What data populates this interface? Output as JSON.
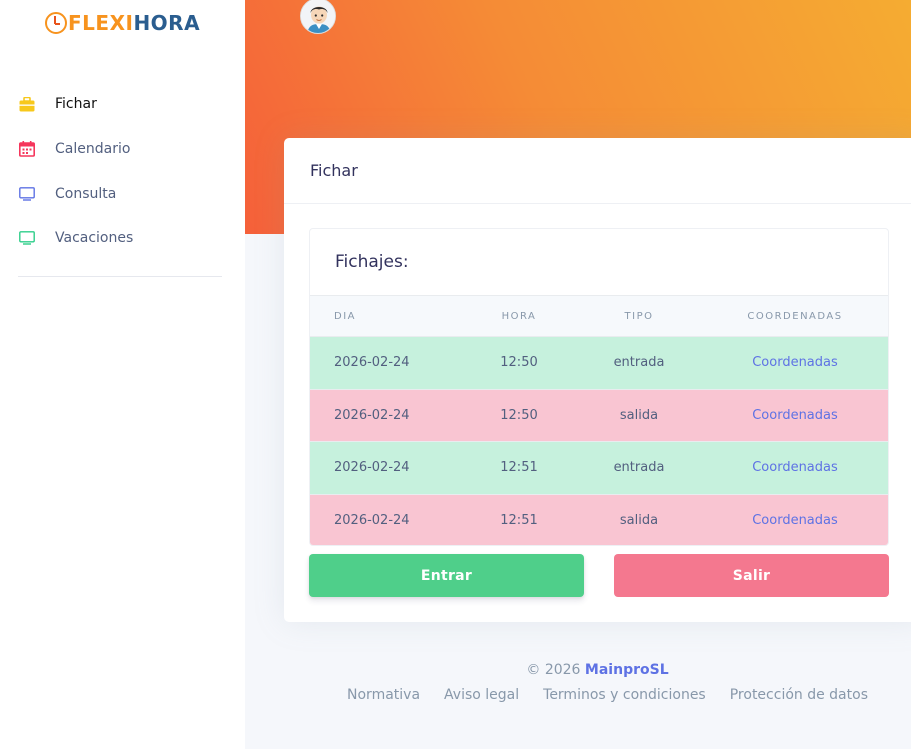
{
  "sidebar": {
    "logo": {
      "part1": "FLEXI",
      "part2": "HORA"
    },
    "items": [
      {
        "label": "Fichar",
        "icon": "briefcase-icon",
        "color": "#f7c81b"
      },
      {
        "label": "Calendario",
        "icon": "calendar-icon",
        "color": "#f5365c"
      },
      {
        "label": "Consulta",
        "icon": "monitor-icon",
        "color": "#5e72e4"
      },
      {
        "label": "Vacaciones",
        "icon": "monitor-icon",
        "color": "#2dce89"
      }
    ]
  },
  "card": {
    "title": "Fichar",
    "inner_title": "Fichajes:",
    "columns": [
      "Dia",
      "Hora",
      "Tipo",
      "Coordenadas"
    ],
    "rows": [
      {
        "dia": "2026-02-24",
        "hora": "12:50",
        "tipo": "entrada",
        "coord": "Coordenadas"
      },
      {
        "dia": "2026-02-24",
        "hora": "12:50",
        "tipo": "salida",
        "coord": "Coordenadas"
      },
      {
        "dia": "2026-02-24",
        "hora": "12:51",
        "tipo": "entrada",
        "coord": "Coordenadas"
      },
      {
        "dia": "2026-02-24",
        "hora": "12:51",
        "tipo": "salida",
        "coord": "Coordenadas"
      }
    ],
    "enter_label": "Entrar",
    "exit_label": "Salir"
  },
  "footer": {
    "copyright": "© 2026",
    "company": "MainproSL",
    "links": [
      "Normativa",
      "Aviso legal",
      "Terminos y condiciones",
      "Protección de datos"
    ]
  },
  "colors": {
    "accent": "#5e72e4",
    "entrada_row": "#c6f1dd",
    "salida_row": "#f9c5d2",
    "enter_button": "#4fcf8a",
    "exit_button": "#f4788f"
  }
}
